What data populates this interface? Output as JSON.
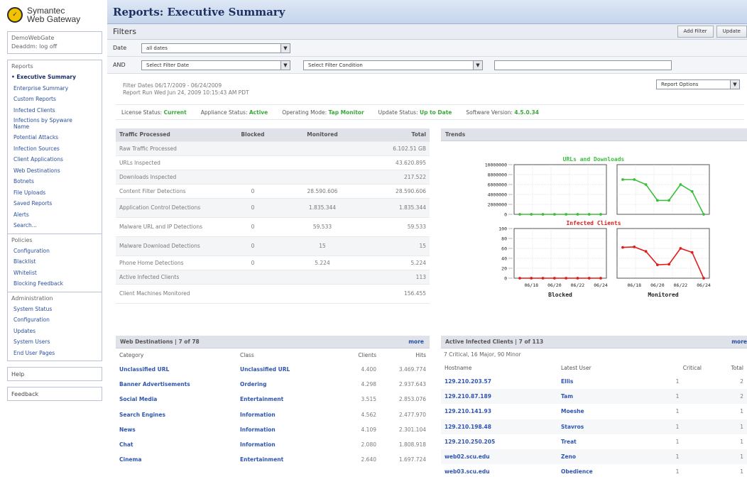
{
  "brand": {
    "line1": "Symantec",
    "line2": "Web Gateway"
  },
  "user": {
    "gateway": "DemoWebGate",
    "user_label": "Deaddm: log off"
  },
  "sidebar": {
    "reports_head": "Reports",
    "reports": [
      "Executive Summary",
      "Enterprise Summary",
      "Custom Reports",
      "Infected Clients",
      "Infections by Spyware Name",
      "Potential Attacks",
      "Infection Sources",
      "Client Applications",
      "Web Destinations",
      "Botnets",
      "File Uploads",
      "Saved Reports",
      "Alerts",
      "Search..."
    ],
    "policies_head": "Policies",
    "policies": [
      "Configuration",
      "Blacklist",
      "Whitelist",
      "Blocking Feedback"
    ],
    "admin_head": "Administration",
    "admin": [
      "System Status",
      "Configuration",
      "Updates",
      "System Users",
      "End User Pages"
    ],
    "help": "Help",
    "feedback": "Feedback"
  },
  "page": {
    "title": "Reports: Executive Summary"
  },
  "filters": {
    "label": "Filters",
    "add_filter": "Add Filter",
    "update": "Update",
    "date_label": "Date",
    "date_value": "all dates",
    "and_label": "AND",
    "filter_date": "Select Filter Date",
    "filter_condition": "Select Filter Condition",
    "filter_text": ""
  },
  "meta": {
    "filter_dates": "Filter Dates  06/17/2009 - 06/24/2009",
    "report_run": "Report Run   Wed Jun 24, 2009 10:15:43 AM PDT",
    "report_options": "Report Options"
  },
  "status": {
    "license_label": "License Status:",
    "license": "Current",
    "appliance_label": "Appliance Status:",
    "appliance": "Active",
    "mode_label": "Operating Mode:",
    "mode": "Tap Monitor",
    "update_label": "Update Status:",
    "update": "Up to Date",
    "version_label": "Software Version:",
    "version": "4.5.0.34"
  },
  "traffic": {
    "headers": [
      "Traffic Processed",
      "Blocked",
      "Monitored",
      "Total"
    ],
    "rows": [
      [
        "Raw Traffic Processed",
        "",
        "",
        "6.102.51 GB"
      ],
      [
        "URLs Inspected",
        "",
        "",
        "43.620.895"
      ],
      [
        "Downloads Inspected",
        "",
        "",
        "217.522"
      ],
      [
        "Content Filter Detections",
        "0",
        "28.590.606",
        "28.590.606"
      ],
      [
        "Application Control Detections",
        "0",
        "1.835.344",
        "1.835.344"
      ],
      [
        "Malware URL and IP Detections",
        "0",
        "59.533",
        "59.533"
      ],
      [
        "Malware Download Detections",
        "0",
        "15",
        "15"
      ],
      [
        "Phone Home Detections",
        "0",
        "5.224",
        "5.224"
      ],
      [
        "Active Infected Clients",
        "",
        "",
        "113"
      ],
      [
        "Client Machines Monitored",
        "",
        "",
        "156.455"
      ]
    ]
  },
  "trends": {
    "head": "Trends",
    "top_title": "URLs and Downloads",
    "bottom_title": "Infected Clients",
    "top_ticks": [
      "10000000",
      "8000000",
      "6000000",
      "4000000",
      "2000000",
      "0"
    ],
    "bottom_ticks": [
      "100",
      "80",
      "60",
      "40",
      "20",
      "0"
    ],
    "x_ticks": [
      "06/18",
      "06/20",
      "06/22",
      "06/24"
    ],
    "col_blocked": "Blocked",
    "col_monitored": "Monitored"
  },
  "chart_data": {
    "type": "line",
    "dates": [
      "06/17",
      "06/18",
      "06/19",
      "06/20",
      "06/21",
      "06/22",
      "06/23",
      "06/24"
    ],
    "panels": [
      {
        "row": "URLs and Downloads",
        "col": "Blocked",
        "color": "#3cbf3c",
        "ylim": [
          0,
          10000000
        ],
        "values": [
          0,
          0,
          0,
          0,
          0,
          0,
          0,
          0
        ]
      },
      {
        "row": "URLs and Downloads",
        "col": "Monitored",
        "color": "#3cbf3c",
        "ylim": [
          0,
          10000000
        ],
        "values": [
          7000000,
          7000000,
          6000000,
          2800000,
          2800000,
          6000000,
          4600000,
          0
        ]
      },
      {
        "row": "Infected Clients",
        "col": "Blocked",
        "color": "#e01c1c",
        "ylim": [
          0,
          100
        ],
        "values": [
          0,
          0,
          0,
          0,
          0,
          0,
          0,
          0
        ]
      },
      {
        "row": "Infected Clients",
        "col": "Monitored",
        "color": "#e01c1c",
        "ylim": [
          0,
          100
        ],
        "values": [
          62,
          63,
          54,
          27,
          28,
          60,
          52,
          0
        ]
      }
    ]
  },
  "web_dest": {
    "head": "Web Destinations | 7 of 78",
    "more": "more",
    "headers": [
      "Category",
      "Class",
      "Clients",
      "Hits"
    ],
    "rows": [
      [
        "Unclassified URL",
        "Unclassified URL",
        "4.400",
        "3.469.774"
      ],
      [
        "Banner Advertisements",
        "Ordering",
        "4.298",
        "2.937.643"
      ],
      [
        "Social Media",
        "Entertainment",
        "3.515",
        "2.853.076"
      ],
      [
        "Search Engines",
        "Information",
        "4.562",
        "2.477.970"
      ],
      [
        "News",
        "Information",
        "4.109",
        "2.301.104"
      ],
      [
        "Chat",
        "Information",
        "2.080",
        "1.808.918"
      ],
      [
        "Cinema",
        "Entertainment",
        "2.640",
        "1.697.724"
      ]
    ]
  },
  "infected": {
    "head": "Active Infected Clients | 7 of 113",
    "more": "more",
    "summary": "7 Critical, 16 Major, 90 Minor",
    "headers": [
      "Hostname",
      "Latest User",
      "Critical",
      "Total"
    ],
    "rows": [
      [
        "129.210.203.57",
        "Ellis",
        "1",
        "2"
      ],
      [
        "129.210.87.189",
        "Tam",
        "1",
        "2"
      ],
      [
        "129.210.141.93",
        "Moeshe",
        "1",
        "1"
      ],
      [
        "129.210.198.48",
        "Stavros",
        "1",
        "1"
      ],
      [
        "129.210.250.205",
        "Treat",
        "1",
        "1"
      ],
      [
        "web02.scu.edu",
        "Zeno",
        "1",
        "1"
      ],
      [
        "web03.scu.edu",
        "Obedience",
        "1",
        "1"
      ]
    ]
  }
}
